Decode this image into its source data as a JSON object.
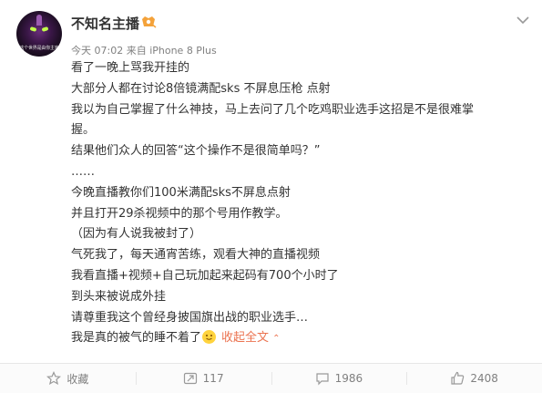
{
  "post": {
    "author": "不知名主播",
    "meta": "今天 07:02 来自 iPhone 8 Plus",
    "avatar_caption": "这个世界是由你主宰",
    "lines": [
      "看了一晚上骂我开挂的",
      "大部分人都在讨论8倍镜满配sks 不屏息压枪 点射",
      "我以为自己掌握了什么神技，马上去问了几个吃鸡职业选手这招是不是很难掌",
      "握。",
      "结果他们众人的回答“这个操作不是很简单吗？”",
      "……",
      "今晚直播教你们100米满配sks不屏息点射",
      "并且打开29杀视频中的那个号用作教学。",
      "（因为有人说我被封了）",
      "气死我了，每天通宵苦练，观看大神的直播视频",
      "我看直播+视频+自己玩加起来起码有700个小时了",
      "到头来被说成外挂",
      "请尊重我这个曾经身披国旗出战的职业选手…",
      "我是真的被气的睡不着了"
    ],
    "collapse_label": "收起全文",
    "emoji_icon": "smile-emoji-icon"
  },
  "actions": {
    "favorite": "收藏",
    "repost": "117",
    "comment": "1986",
    "like": "2408"
  },
  "colors": {
    "link": "#eb7350",
    "meta": "#808080",
    "text": "#333333"
  }
}
